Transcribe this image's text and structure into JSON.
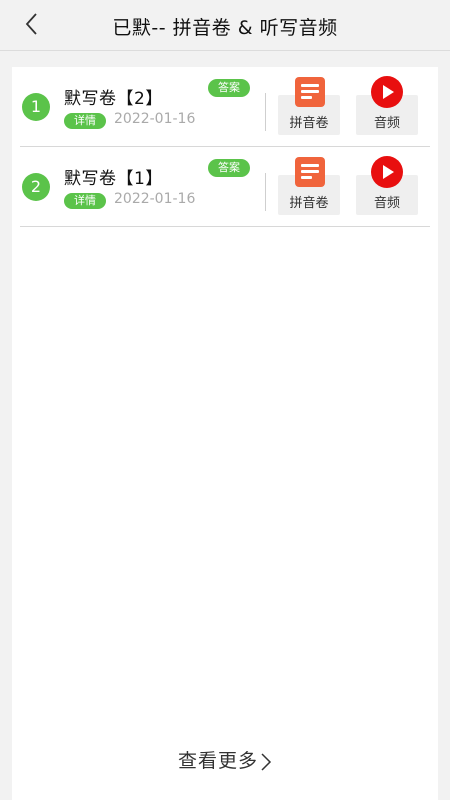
{
  "header": {
    "title": "已默--  拼音卷 & 听写音频",
    "back_icon": "chevron-left-icon"
  },
  "list": [
    {
      "number": "1",
      "title": "默写卷【2】",
      "answer_label": "答案",
      "detail_label": "详情",
      "date": "2022-01-16",
      "pinyin_label": "拼音卷",
      "audio_label": "音频"
    },
    {
      "number": "2",
      "title": "默写卷【1】",
      "answer_label": "答案",
      "detail_label": "详情",
      "date": "2022-01-16",
      "pinyin_label": "拼音卷",
      "audio_label": "音频"
    }
  ],
  "footer": {
    "more_label": "查看更多"
  },
  "colors": {
    "accent_green": "#5bc34a",
    "doc_orange": "#f0643c",
    "play_red": "#e80f0f"
  }
}
